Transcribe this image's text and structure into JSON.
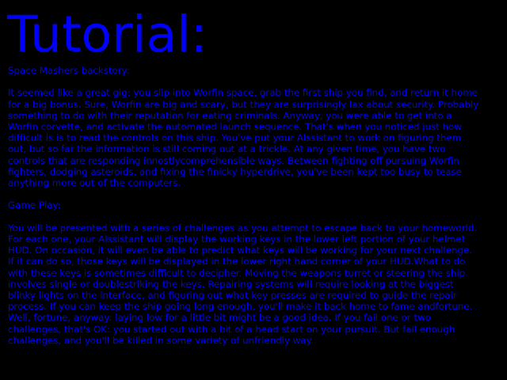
{
  "colors": {
    "background": "#000000",
    "text": "#0000ff"
  },
  "title": "Tutorial:",
  "sections": {
    "backstory_heading": "Space Mashers backstory:",
    "backstory_text": "It seemed like a great gig: you slip into Worfin space, grab the first ship you find, and return it home for a big bonus. Sure, Worfin are big and scary, but they are surprisingly lax about security. Probably something to do with their reputation for eating criminals. Anyway, you were able to get into a Worfin corvette, and activate the automated launch sequence. That's when you noticed just how difficult is is to read the controls on this ship. You've put your AIssistant to work on figuring them out, but so far the information is still coming out at a trickle. At any given time, you have two controls that are responding innostlycomprehensible ways. Between fighting off pursuing Worfin fighters, dodging asteroids, and fixing the finicky hyperdrive, you've been kept too busy to tease anything more out of the computers.",
    "gameplay_heading": "Game Play:",
    "gameplay_text": "You will be presented with a series of challenges as you attempt to escape back to your homeworld. For each one, your AIssistant will display the working keys in the lower left portion of your helmet HUD. On occasion, it will even be able to predict what keys will be working for your next challenge. If it can do so, those keys will be displayed in the lower right hand corner of your HUD.What to do with these keys is sometimes difficult to decipher. Moving the weapons turret or steering the ship involves single or doublestriking the keys. Repairing systems will require looking at the biggest blinky lights on the interface, and figuring out what key presses are required to guide the repair process. If you can keep the ship going long enough, you'll make it back home to fame andfortune. Well, fortune, anyway: laying low for a little bit might be a good idea. If you fail one or two challenges, that's OK: you started out with a bit of a head start on your pursuit. But fail enough challenges, and you'll be killed in some variety of unfriendly way."
  }
}
